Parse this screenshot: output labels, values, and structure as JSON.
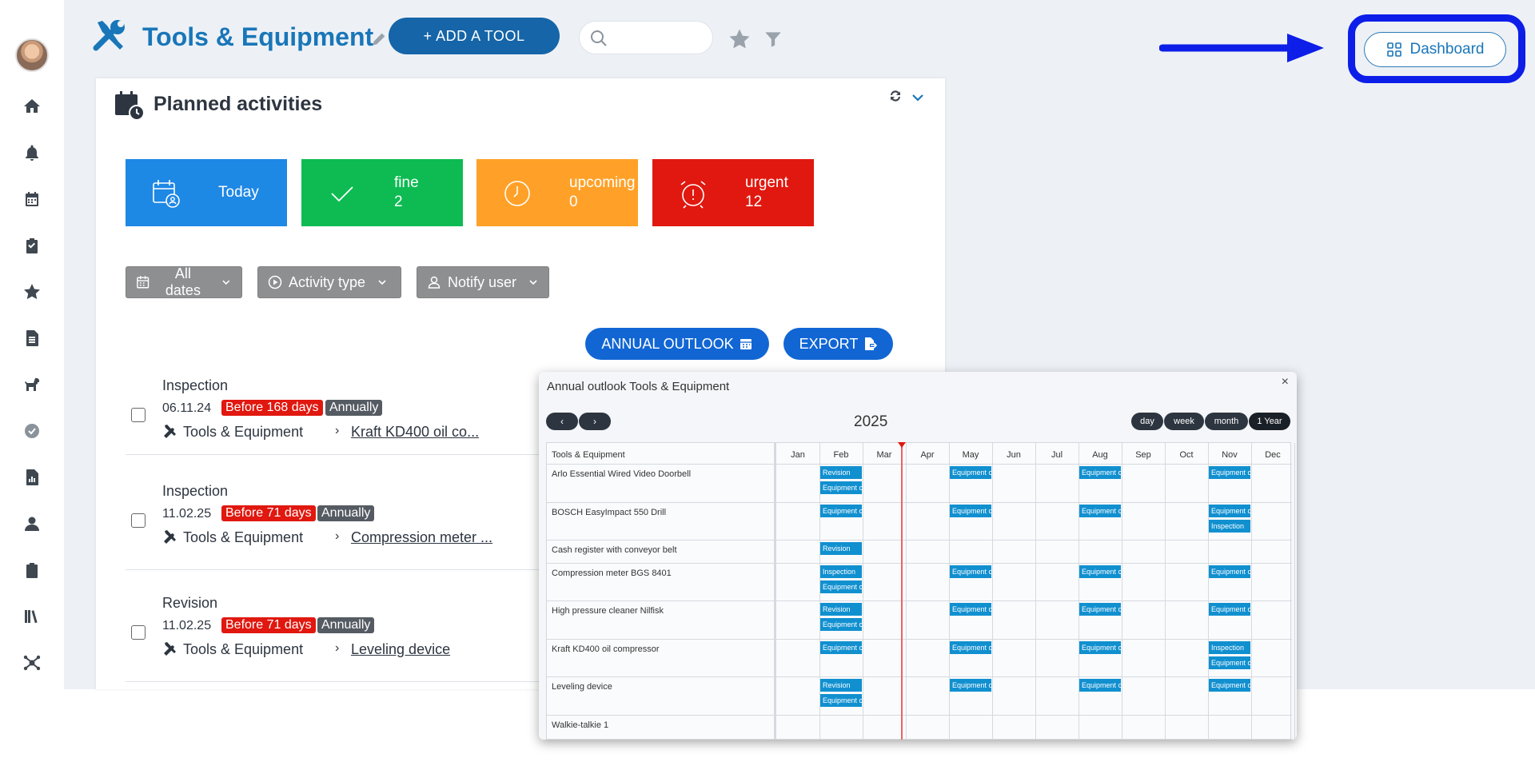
{
  "header": {
    "title": "Tools & Equipment",
    "add_tool_label": "+ ADD A TOOL",
    "search_placeholder": "",
    "dashboard_label": "Dashboard"
  },
  "panel": {
    "title": "Planned activities",
    "tiles": {
      "today": {
        "label": "Today"
      },
      "fine": {
        "label": "fine",
        "count": "2"
      },
      "upcoming": {
        "label": "upcoming",
        "count": "0"
      },
      "urgent": {
        "label": "urgent",
        "count": "12"
      }
    },
    "filters": {
      "all_dates": "All dates",
      "activity_type": "Activity type",
      "notify_user": "Notify user"
    },
    "annual_outlook_label": "ANNUAL OUTLOOK",
    "export_label": "EXPORT",
    "activities": [
      {
        "name": "Inspection",
        "date": "06.11.24",
        "before": "Before 168 days",
        "interval": "Annually",
        "category": "Tools & Equipment",
        "item": "Kraft KD400 oil co..."
      },
      {
        "name": "Inspection",
        "date": "11.02.25",
        "before": "Before 71 days",
        "interval": "Annually",
        "category": "Tools & Equipment",
        "item": "Compression meter ..."
      },
      {
        "name": "Revision",
        "date": "11.02.25",
        "before": "Before 71 days",
        "interval": "Annually",
        "category": "Tools & Equipment",
        "item": "Leveling device"
      }
    ]
  },
  "popup": {
    "title": "Annual outlook Tools & Equipment",
    "close": "×",
    "prev": "‹",
    "next": "›",
    "year": "2025",
    "views": [
      "day",
      "week",
      "month",
      "1 Year"
    ],
    "active_view": "1 Year",
    "column_label": "Tools & Equipment",
    "months": [
      "Jan",
      "Feb",
      "Mar",
      "Apr",
      "May",
      "Jun",
      "Jul",
      "Aug",
      "Sep",
      "Oct",
      "Nov",
      "Dec"
    ],
    "rows": [
      {
        "label": "Arlo Essential Wired Video Doorbell",
        "bars": [
          {
            "m": 1,
            "slot": 0,
            "text": "Revision"
          },
          {
            "m": 1,
            "slot": 1,
            "text": "Equipment c"
          },
          {
            "m": 4,
            "slot": 0,
            "text": "Equipment c"
          },
          {
            "m": 7,
            "slot": 0,
            "text": "Equipment c"
          },
          {
            "m": 10,
            "slot": 0,
            "text": "Equipment c"
          }
        ]
      },
      {
        "label": "BOSCH EasyImpact 550 Drill",
        "bars": [
          {
            "m": 1,
            "slot": 0,
            "text": "Equipment c"
          },
          {
            "m": 4,
            "slot": 0,
            "text": "Equipment c"
          },
          {
            "m": 7,
            "slot": 0,
            "text": "Equipment c"
          },
          {
            "m": 10,
            "slot": 0,
            "text": "Equipment c"
          },
          {
            "m": 10,
            "slot": 1,
            "text": "Inspection"
          }
        ]
      },
      {
        "label": "Cash register with conveyor belt",
        "bars": [
          {
            "m": 1,
            "slot": 0,
            "text": "Revision"
          }
        ]
      },
      {
        "label": "Compression meter BGS 8401",
        "bars": [
          {
            "m": 1,
            "slot": 0,
            "text": "Inspection"
          },
          {
            "m": 1,
            "slot": 1,
            "text": "Equipment c"
          },
          {
            "m": 4,
            "slot": 0,
            "text": "Equipment c"
          },
          {
            "m": 7,
            "slot": 0,
            "text": "Equipment c"
          },
          {
            "m": 10,
            "slot": 0,
            "text": "Equipment c"
          }
        ]
      },
      {
        "label": "High pressure cleaner Nilfisk",
        "bars": [
          {
            "m": 1,
            "slot": 0,
            "text": "Revision"
          },
          {
            "m": 1,
            "slot": 1,
            "text": "Equipment c"
          },
          {
            "m": 4,
            "slot": 0,
            "text": "Equipment c"
          },
          {
            "m": 7,
            "slot": 0,
            "text": "Equipment c"
          },
          {
            "m": 10,
            "slot": 0,
            "text": "Equipment c"
          }
        ]
      },
      {
        "label": "Kraft KD400 oil compressor",
        "bars": [
          {
            "m": 1,
            "slot": 0,
            "text": "Equipment c"
          },
          {
            "m": 4,
            "slot": 0,
            "text": "Equipment c"
          },
          {
            "m": 7,
            "slot": 0,
            "text": "Equipment c"
          },
          {
            "m": 10,
            "slot": 0,
            "text": "Inspection"
          },
          {
            "m": 10,
            "slot": 1,
            "text": "Equipment c"
          }
        ]
      },
      {
        "label": "Leveling device",
        "bars": [
          {
            "m": 1,
            "slot": 0,
            "text": "Revision"
          },
          {
            "m": 1,
            "slot": 1,
            "text": "Equipment c"
          },
          {
            "m": 4,
            "slot": 0,
            "text": "Equipment c"
          },
          {
            "m": 7,
            "slot": 0,
            "text": "Equipment c"
          },
          {
            "m": 10,
            "slot": 0,
            "text": "Equipment c"
          }
        ]
      },
      {
        "label": "Walkie-talkie 1",
        "bars": []
      }
    ]
  },
  "colors": {
    "brand_blue": "#1976b8",
    "add_button": "#1565a8",
    "today_tile": "#1e88e5",
    "fine_tile": "#0dbb52",
    "upcoming_tile": "#ffa128",
    "urgent_tile": "#e0180f",
    "gantt_bar": "#1190d0",
    "highlight": "#0d1ee8"
  },
  "icons": {
    "sidebar": [
      "home-icon",
      "bell-icon",
      "calendar-icon",
      "clipboard-check-icon",
      "star-icon",
      "document-icon",
      "dog-icon",
      "check-circle-icon",
      "report-icon",
      "user-icon",
      "clipboard-icon",
      "library-icon",
      "network-icon"
    ]
  }
}
